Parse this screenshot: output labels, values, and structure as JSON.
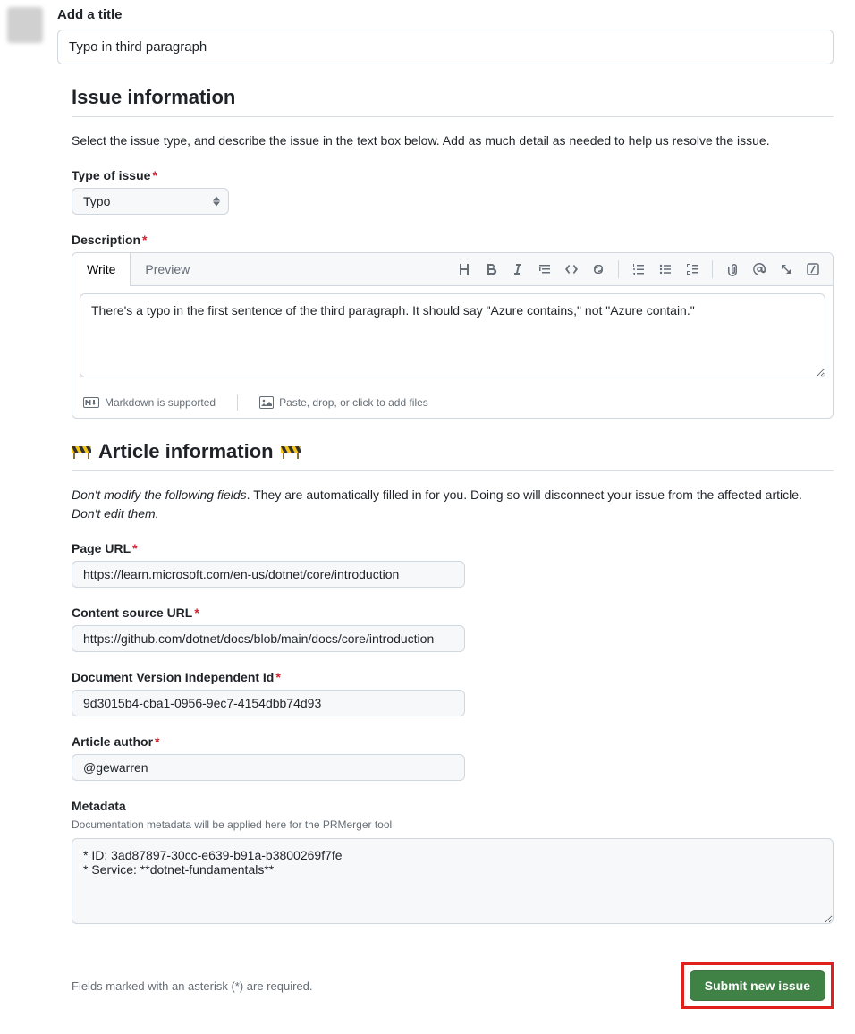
{
  "titleSection": {
    "label": "Add a title",
    "value": "Typo in third paragraph"
  },
  "issueInfo": {
    "heading": "Issue information",
    "description": "Select the issue type, and describe the issue in the text box below. Add as much detail as needed to help us resolve the issue.",
    "typeLabel": "Type of issue",
    "typeValue": "Typo",
    "descLabel": "Description",
    "writeTab": "Write",
    "previewTab": "Preview",
    "descValue": "There's a typo in the first sentence of the third paragraph. It should say \"Azure contains,\" not \"Azure contain.\"",
    "markdownNote": "Markdown is supported",
    "attachNote": "Paste, drop, or click to add files"
  },
  "articleInfo": {
    "heading": "Article information",
    "descPrefixItalic": "Don't modify the following fields",
    "descRest": ". They are automatically filled in for you. Doing so will disconnect your issue from the affected article. ",
    "descEndItalic": "Don't edit them.",
    "pageUrlLabel": "Page URL",
    "pageUrlValue": "https://learn.microsoft.com/en-us/dotnet/core/introduction",
    "contentSourceLabel": "Content source URL",
    "contentSourceValue": "https://github.com/dotnet/docs/blob/main/docs/core/introduction",
    "docVersionLabel": "Document Version Independent Id",
    "docVersionValue": "9d3015b4-cba1-0956-9ec7-4154dbb74d93",
    "authorLabel": "Article author",
    "authorValue": "@gewarren",
    "metadataLabel": "Metadata",
    "metadataHelp": "Documentation metadata will be applied here for the PRMerger tool",
    "metadataValue": "* ID: 3ad87897-30cc-e639-b91a-b3800269f7fe\n* Service: **dotnet-fundamentals**"
  },
  "footer": {
    "note": "Fields marked with an asterisk (*) are required.",
    "submit": "Submit new issue"
  }
}
